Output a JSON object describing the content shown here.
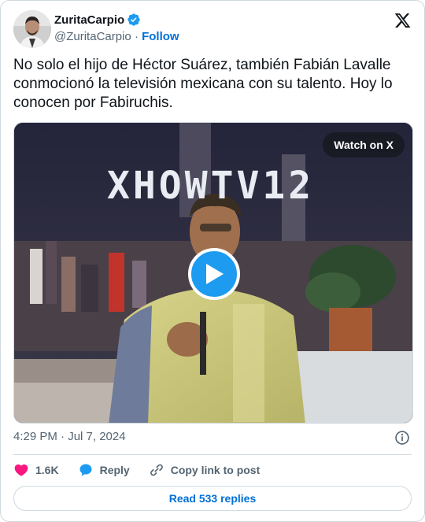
{
  "author": {
    "display_name": "ZuritaCarpio",
    "handle": "@ZuritaCarpio",
    "separator": "·",
    "follow_label": "Follow",
    "verified_icon": "verified-badge-icon",
    "brand_icon": "x-logo-icon"
  },
  "tweet": {
    "text": "No solo el hijo de Héctor Suárez, también Fabián Lavalle conmocionó la televisión mexicana con su talento. Hoy lo conocen por Fabiruchis."
  },
  "media": {
    "watch_label": "Watch on X",
    "overlay_text": "XHOWTV12",
    "play_icon": "play-icon"
  },
  "meta": {
    "timestamp": "4:29 PM · Jul 7, 2024",
    "info_icon": "info-icon"
  },
  "actions": {
    "likes_count": "1.6K",
    "reply_label": "Reply",
    "copy_label": "Copy link to post"
  },
  "footer": {
    "read_replies_label": "Read 533 replies"
  },
  "colors": {
    "accent": "#1d9bf0",
    "link": "#006fd6",
    "heart": "#f91880",
    "muted": "#536471",
    "border": "#cfd9de"
  }
}
